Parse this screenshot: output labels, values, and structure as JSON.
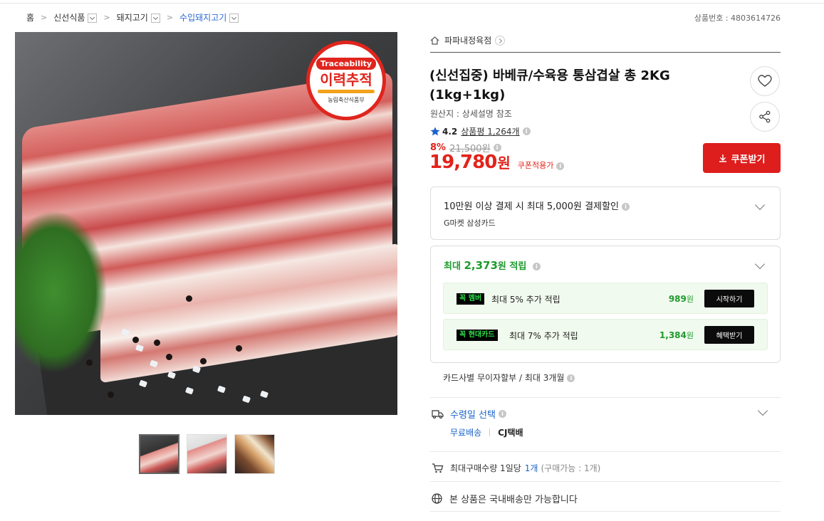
{
  "breadcrumb": {
    "items": [
      "홈",
      "신선식품",
      "돼지고기",
      "수입돼지고기"
    ]
  },
  "product_no": "상품번호 : 4803614726",
  "image": {
    "badge_top": "Traceability",
    "badge_main": "이력추적",
    "badge_sub": "농림축산식품부"
  },
  "seller": {
    "name": "파파내정육점"
  },
  "title": "(신선집중) 바베큐/수육용 통삼겹살 총 2KG (1kg+1kg)",
  "origin": "원산지 : 상세설명 참조",
  "rating": {
    "score": "4.2",
    "reviews": "상품평 1,264개"
  },
  "price": {
    "discount": "8%",
    "original": "21,500원",
    "value": "19,780",
    "unit": "원",
    "label": "쿠폰적용가"
  },
  "coupon_button": "쿠폰받기",
  "card_discount": {
    "title": "10만원 이상 결제 시 최대 5,000원 결제할인",
    "sub": "G마켓 삼성카드"
  },
  "points": {
    "prefix": "최대",
    "amount": "2,373",
    "suffix": "원 적립",
    "rows": [
      {
        "tag_a": "꼭",
        "tag_b": "멤버",
        "text": "최대 5% 추가 적립",
        "amount": "989",
        "unit": "원",
        "button": "시작하기"
      },
      {
        "tag_a": "꼭",
        "tag_b": "현대카드",
        "text": "최대 7% 추가 적립",
        "amount": "1,384",
        "unit": "원",
        "button": "혜택받기"
      }
    ]
  },
  "installment": "카드사별 무이자할부 / 최대 3개월",
  "delivery": {
    "title": "수령일 선택",
    "free": "무료배송",
    "courier": "CJ택배"
  },
  "max_qty": {
    "text": "최대구매수량 1일당",
    "value": "1개",
    "note": "(구매가능 : 1개)"
  },
  "domestic": "본 상품은 국내배송만 가능합니다",
  "colors": {
    "accent_red": "#e2231a",
    "green": "#1f9a2e",
    "link_blue": "#1a63c9"
  }
}
